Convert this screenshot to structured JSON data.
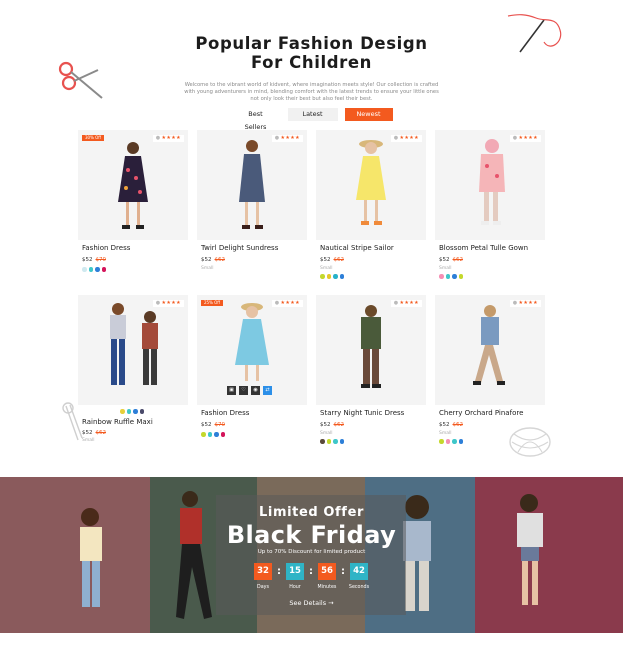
{
  "header": {
    "title_line1": "Popular Fashion Design",
    "title_line2": "For Children",
    "subtitle": "Welcome to the vibrant world of kidvent, where imagination meets style! Our collection is crafted with young adventurers in mind, blending comfort with the latest trends to ensure your little ones not only look their best but also feel their best."
  },
  "tabs": [
    {
      "label": "Best Sellers"
    },
    {
      "label": "Latest"
    },
    {
      "label": "Newest",
      "active": true
    }
  ],
  "products": [
    {
      "name": "Fashion Dress",
      "price": "$52",
      "old_price": "$70",
      "badge": "30% Off",
      "swatches": [
        "#cfe9ef",
        "#3ec7c9",
        "#2d7fd8",
        "#d4145a"
      ]
    },
    {
      "name": "Twirl Delight Sundress",
      "price": "$52",
      "old_price": "$62",
      "size": "Small"
    },
    {
      "name": "Nautical Stripe Sailor",
      "price": "$52",
      "old_price": "$62",
      "size": "Small",
      "swatches": [
        "#c4d82c",
        "#e7c72a",
        "#27b2c9",
        "#2d7fd8"
      ]
    },
    {
      "name": "Blossom Petal Tulle Gown",
      "price": "$52",
      "old_price": "$62",
      "size": "Small",
      "swatches": [
        "#f58fb4",
        "#3ec7c9",
        "#2d7fd8",
        "#c4d82c"
      ]
    },
    {
      "name": "Rainbow Ruffle Maxi",
      "price": "$52",
      "old_price": "$62",
      "size": "Small",
      "swatches": [
        "#e7d03a",
        "#3ec7c9",
        "#2d7fd8",
        "#4a4a6a"
      ]
    },
    {
      "name": "Fashion Dress",
      "price": "$52",
      "old_price": "$70",
      "badge": "25% Off",
      "swatches": [
        "#c4d82c",
        "#3ec7c9",
        "#2d7fd8",
        "#d4145a"
      ]
    },
    {
      "name": "Starry Night Tunic Dress",
      "price": "$52",
      "old_price": "$62",
      "size": "Small",
      "swatches": [
        "#5a4a3a",
        "#c4d82c",
        "#3ec7c9",
        "#2d7fd8"
      ]
    },
    {
      "name": "Cherry Orchard Pinafore",
      "price": "$52",
      "old_price": "$62",
      "size": "Small",
      "swatches": [
        "#c4d82c",
        "#f58fb4",
        "#3ec7c9",
        "#2d7fd8"
      ]
    }
  ],
  "promo": {
    "title": "Limited Offer",
    "headline": "Black Friday",
    "subtitle": "Up to 70% Discount for limited product",
    "countdown": [
      {
        "value": "32",
        "label": "Days",
        "color": "#f35a1f"
      },
      {
        "value": "15",
        "label": "Hour",
        "color": "#2fb4c6"
      },
      {
        "value": "56",
        "label": "Minutes",
        "color": "#f35a1f"
      },
      {
        "value": "42",
        "label": "Seconds",
        "color": "#2fb4c6"
      }
    ],
    "cta": "See Details"
  },
  "colors": {
    "accent": "#f35a1f",
    "teal": "#2fb4c6"
  }
}
